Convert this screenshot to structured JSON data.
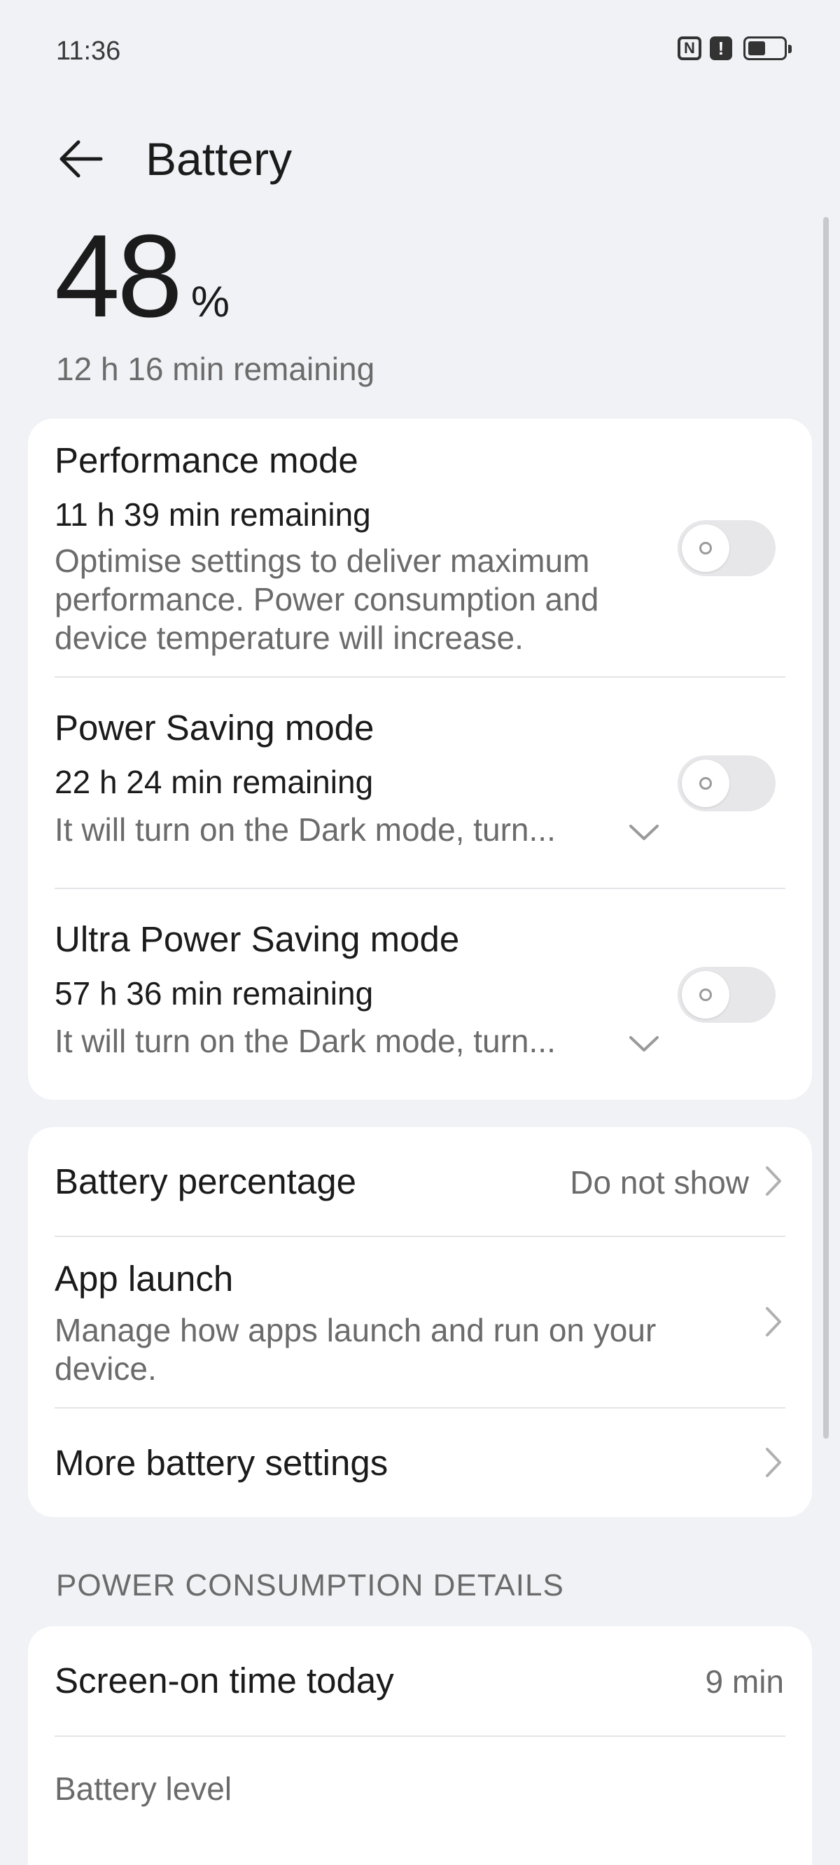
{
  "status_bar": {
    "time": "11:36",
    "nfc_icon": "N",
    "alert_icon": "!",
    "icons": [
      "nfc-icon",
      "alert-icon",
      "battery-icon"
    ]
  },
  "header": {
    "title": "Battery",
    "back_icon": "arrow-left-icon"
  },
  "battery": {
    "percent": "48",
    "unit": "%",
    "remaining": "12 h 16 min remaining",
    "level_fraction": 0.48
  },
  "modes": [
    {
      "title": "Performance mode",
      "remaining": "11 h 39 min remaining",
      "description": "Optimise settings to deliver maximum performance. Power consumption and device temperature will increase.",
      "enabled": false
    },
    {
      "title": "Power Saving mode",
      "remaining": "22 h 24 min remaining",
      "description": "It will turn on the Dark mode, turn...",
      "enabled": false
    },
    {
      "title": "Ultra Power Saving mode",
      "remaining": "57 h 36 min remaining",
      "description": "It will turn on the Dark mode, turn...",
      "enabled": false
    }
  ],
  "settings": {
    "battery_percentage": {
      "label": "Battery percentage",
      "value": "Do not show"
    },
    "app_launch": {
      "label": "App launch",
      "description": "Manage how apps launch and run on your device."
    },
    "more_settings": {
      "label": "More battery settings"
    }
  },
  "details": {
    "section_title": "POWER CONSUMPTION DETAILS",
    "screen_on": {
      "label": "Screen-on time today",
      "value": "9 min"
    },
    "battery_level_label": "Battery level"
  },
  "colors": {
    "background": "#f1f2f6",
    "card": "#ffffff",
    "primary_text": "#1b1b1b",
    "secondary_text": "#6b6b6b",
    "toggle_off": "#e7e7ea"
  }
}
